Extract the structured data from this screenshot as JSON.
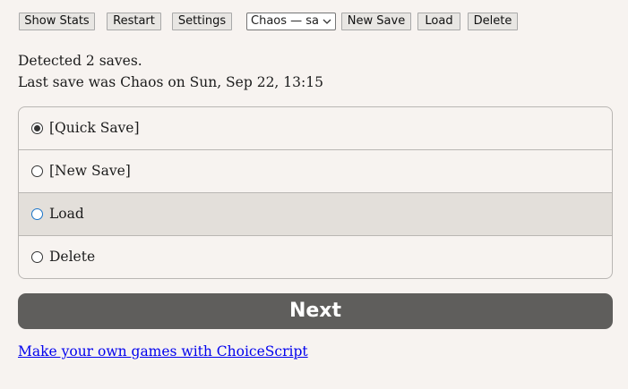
{
  "toolbar": {
    "show_stats": "Show Stats",
    "restart": "Restart",
    "settings": "Settings",
    "save_select_value": "Chaos — save",
    "new_save": "New Save",
    "load": "Load",
    "delete": "Delete"
  },
  "status": {
    "detected": "Detected 2 saves.",
    "last_save": "Last save was Chaos on Sun, Sep 22, 13:15"
  },
  "choices": [
    {
      "label": "[Quick Save]",
      "checked": true
    },
    {
      "label": "[New Save]",
      "checked": false
    },
    {
      "label": "Load",
      "checked": false,
      "hovered": true
    },
    {
      "label": "Delete",
      "checked": false
    }
  ],
  "next_label": "Next",
  "footer_link": "Make your own games with ChoiceScript",
  "colors": {
    "background": "#f7f3f0",
    "next_button": "#5f5e5c",
    "hover_row": "#e3dfda",
    "link": "#0000ee"
  }
}
